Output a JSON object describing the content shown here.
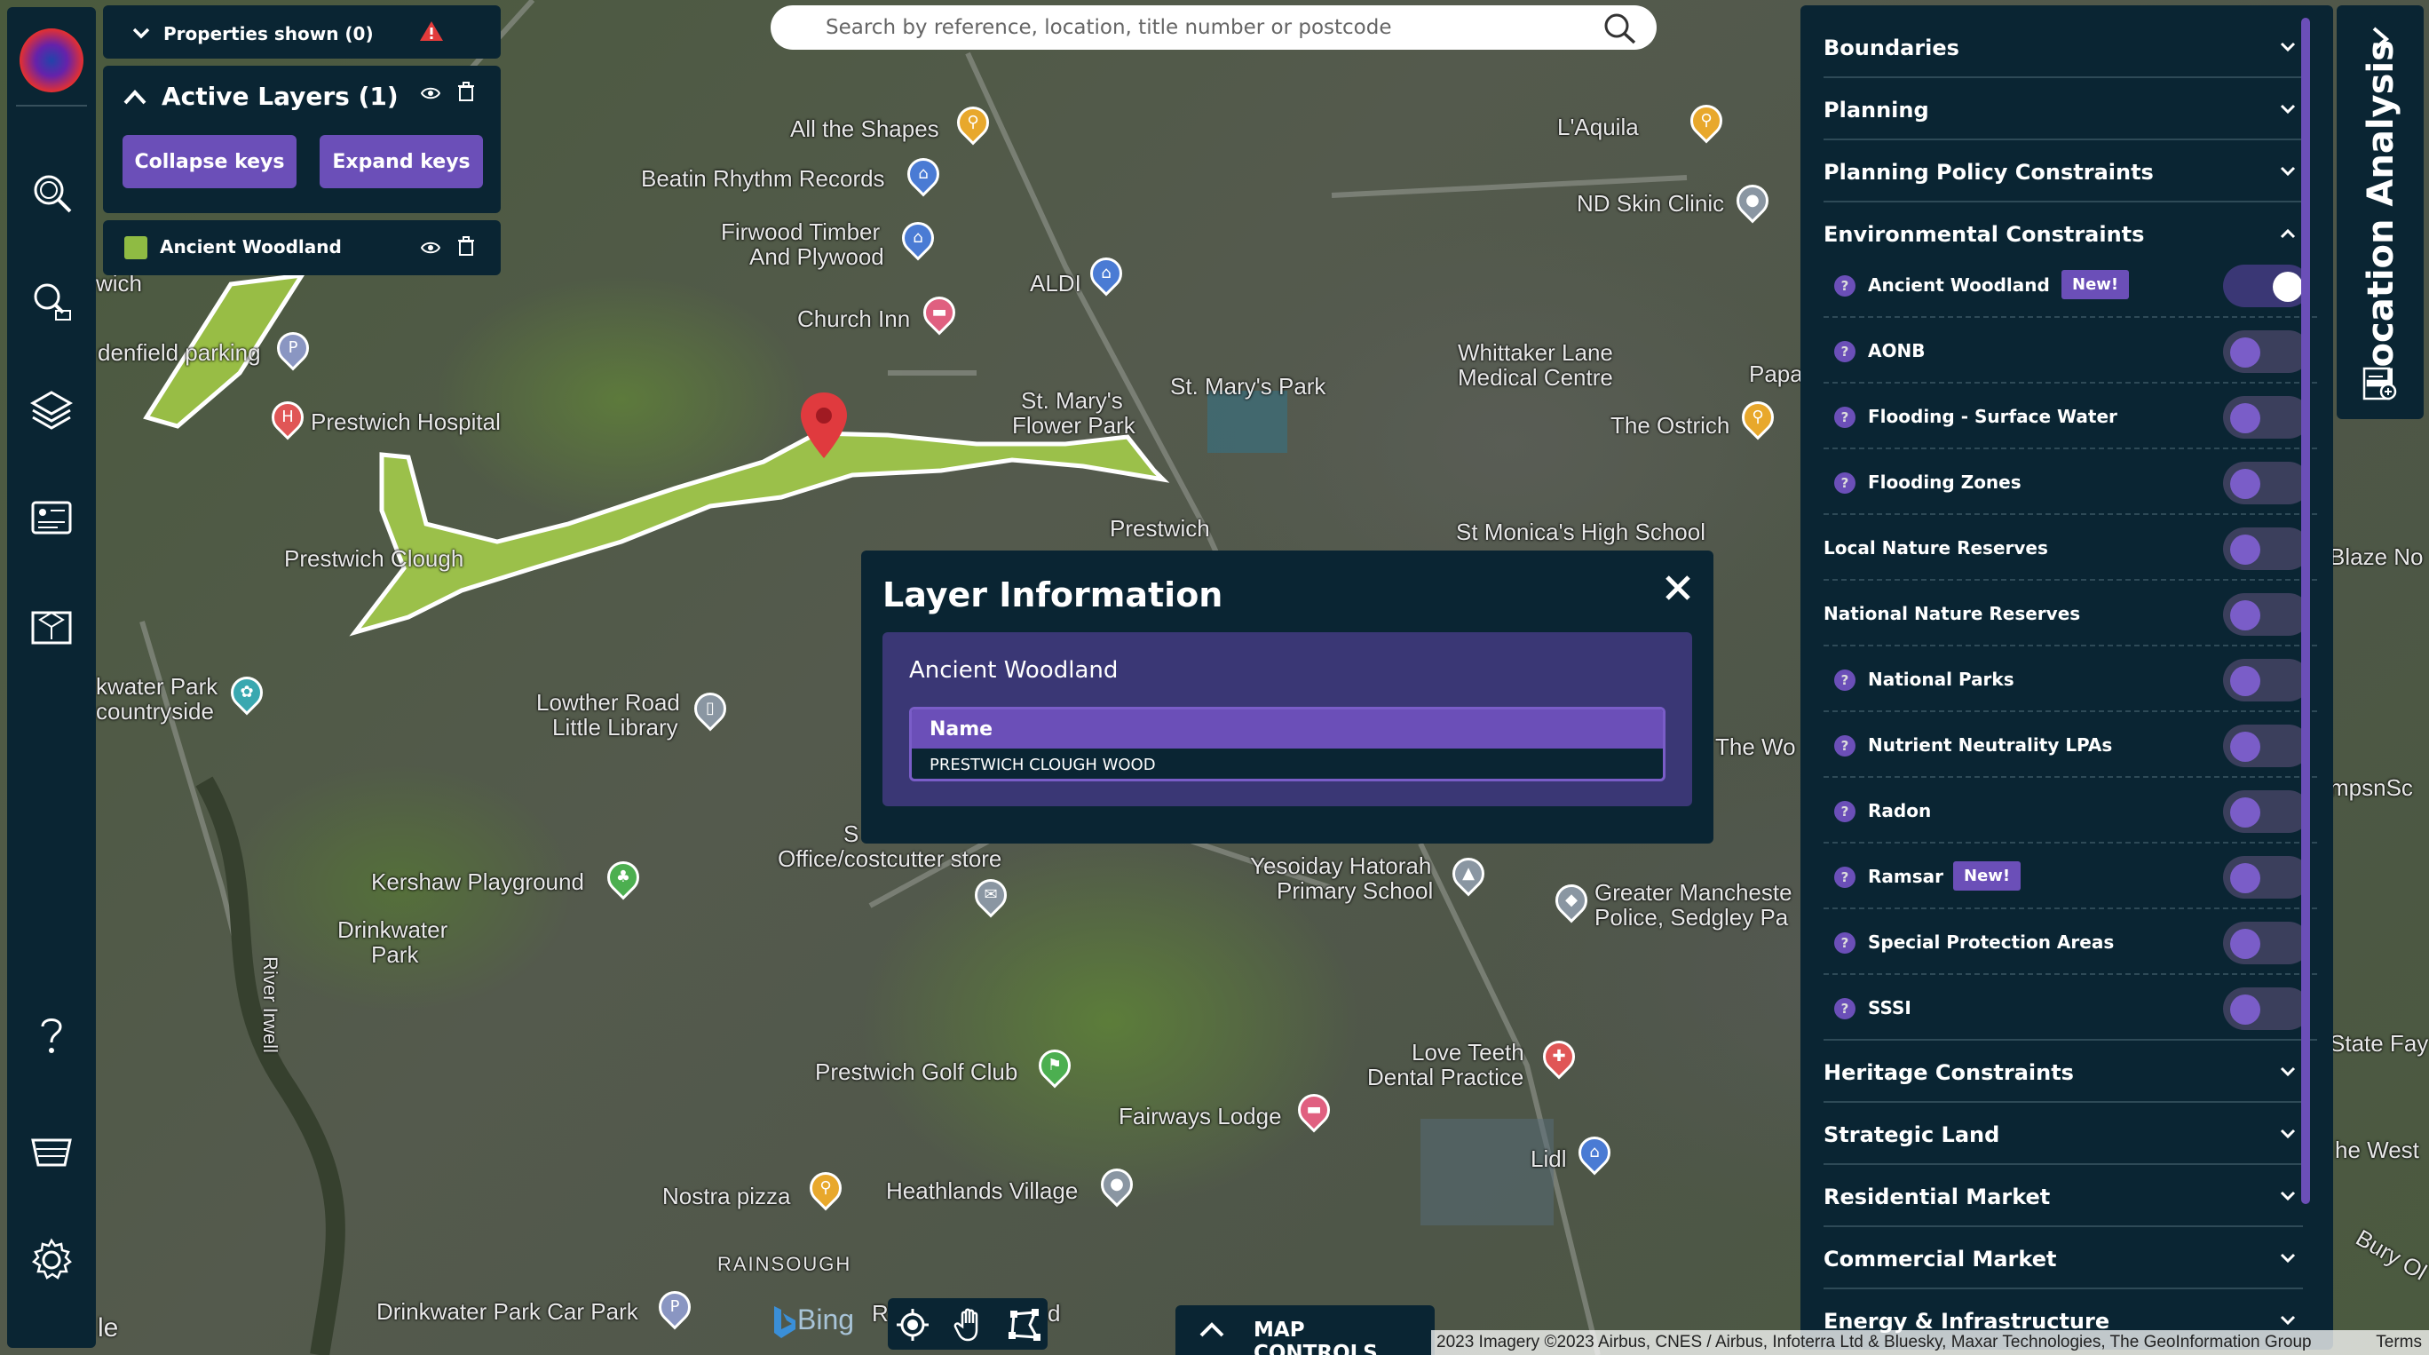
{
  "search": {
    "placeholder": "Search by reference, location, title number or postcode"
  },
  "properties": {
    "label": "Properties shown (0)"
  },
  "active_layers": {
    "title": "Active Layers (1)",
    "collapse_label": "Collapse keys",
    "expand_label": "Expand keys",
    "layer_name": "Ancient Woodland",
    "layer_color": "#8fbb43"
  },
  "modal": {
    "title": "Layer Information",
    "layer_name": "Ancient Woodland",
    "column_header": "Name",
    "cell_value": "PRESTWICH CLOUGH WOOD"
  },
  "right_panel": {
    "categories_top": [
      {
        "label": "Boundaries"
      },
      {
        "label": "Planning"
      },
      {
        "label": "Planning Policy Constraints"
      }
    ],
    "environmental": {
      "label": "Environmental Constraints",
      "items": [
        {
          "label": "Ancient Woodland",
          "help": "?",
          "badge": "New!",
          "on": true
        },
        {
          "label": "AONB",
          "help": "?",
          "on": false
        },
        {
          "label": "Flooding - Surface Water",
          "help": "?",
          "on": false
        },
        {
          "label": "Flooding Zones",
          "help": "?",
          "on": false
        },
        {
          "label": "Local Nature Reserves",
          "on": false
        },
        {
          "label": "National Nature Reserves",
          "on": false
        },
        {
          "label": "National Parks",
          "help": "?",
          "on": false
        },
        {
          "label": "Nutrient Neutrality LPAs",
          "help": "?",
          "on": false
        },
        {
          "label": "Radon",
          "help": "?",
          "on": false
        },
        {
          "label": "Ramsar",
          "help": "?",
          "badge": "New!",
          "on": false
        },
        {
          "label": "Special Protection Areas",
          "help": "?",
          "on": false
        },
        {
          "label": "SSSI",
          "help": "?",
          "on": false
        }
      ]
    },
    "categories_bottom": [
      {
        "label": "Heritage Constraints"
      },
      {
        "label": "Strategic Land"
      },
      {
        "label": "Residential Market"
      },
      {
        "label": "Commercial Market"
      },
      {
        "label": "Energy & Infrastructure"
      }
    ]
  },
  "location_tab": {
    "label": "Location Analysis"
  },
  "map_controls": {
    "label": "MAP CONTROLS"
  },
  "bing": {
    "label": "Bing"
  },
  "attribution": {
    "text": "2023 Imagery ©2023 Airbus, CNES / Airbus, Infoterra Ltd & Bluesky, Maxar Technologies, The GeoInformation Group",
    "terms": "Terms"
  },
  "map_labels": [
    "All the Shapes",
    "Beatin Rhythm Records",
    "Firwood Timber",
    "And Plywood",
    "ALDI",
    "Church Inn",
    "L'Aquila",
    "ND Skin Clinic",
    "St. Mary's Park",
    "St. Mary's",
    "Flower Park",
    "Whittaker Lane",
    "Medical Centre",
    "Papa",
    "The Ostrich",
    "Prestwich Hospital",
    "denfield parking",
    "Prestwich Clough",
    "Prestwich",
    "St Monica's High School",
    "Blaze No",
    "kwater Park",
    "countryside",
    "Lowther Road",
    "Little Library",
    "The Wo",
    "mpsnSc",
    "Office/costcutter store",
    "S",
    "Yesoiday Hatorah",
    "Primary School",
    "Greater Mancheste",
    "Police, Sedgley Pa",
    "Kershaw Playground",
    "Drinkwater",
    "Park",
    "River Irwell",
    "Prestwich Golf Club",
    "Love Teeth",
    "Dental Practice",
    "Fairways Lodge",
    "Lidl",
    "State Fay",
    "he West",
    "Bury Ol",
    "Nostra pizza",
    "Heathlands Village",
    "RAINSOUGH",
    "Drinkwater Park Car Park",
    "wich",
    "le",
    "R",
    "d"
  ],
  "colors": {
    "panel_bg": "#0a2533",
    "accent": "#6b4fb8",
    "woodland": "#8fbb43",
    "pin_red": "#e03a3e"
  }
}
